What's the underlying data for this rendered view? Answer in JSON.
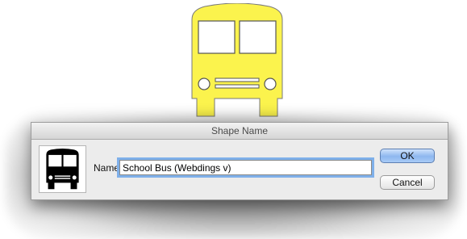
{
  "shape": {
    "icon": "school-bus-icon",
    "fill_color": "#fbf34d",
    "stroke_color": "#7a7a7a",
    "preview_color": "#000000"
  },
  "dialog": {
    "title": "Shape Name",
    "name_label": "Name:",
    "name_value": "School Bus (Webdings v)",
    "ok_label": "OK",
    "cancel_label": "Cancel",
    "focus_color": "#7fb0ea",
    "default_button_color": "#8db7ef"
  }
}
